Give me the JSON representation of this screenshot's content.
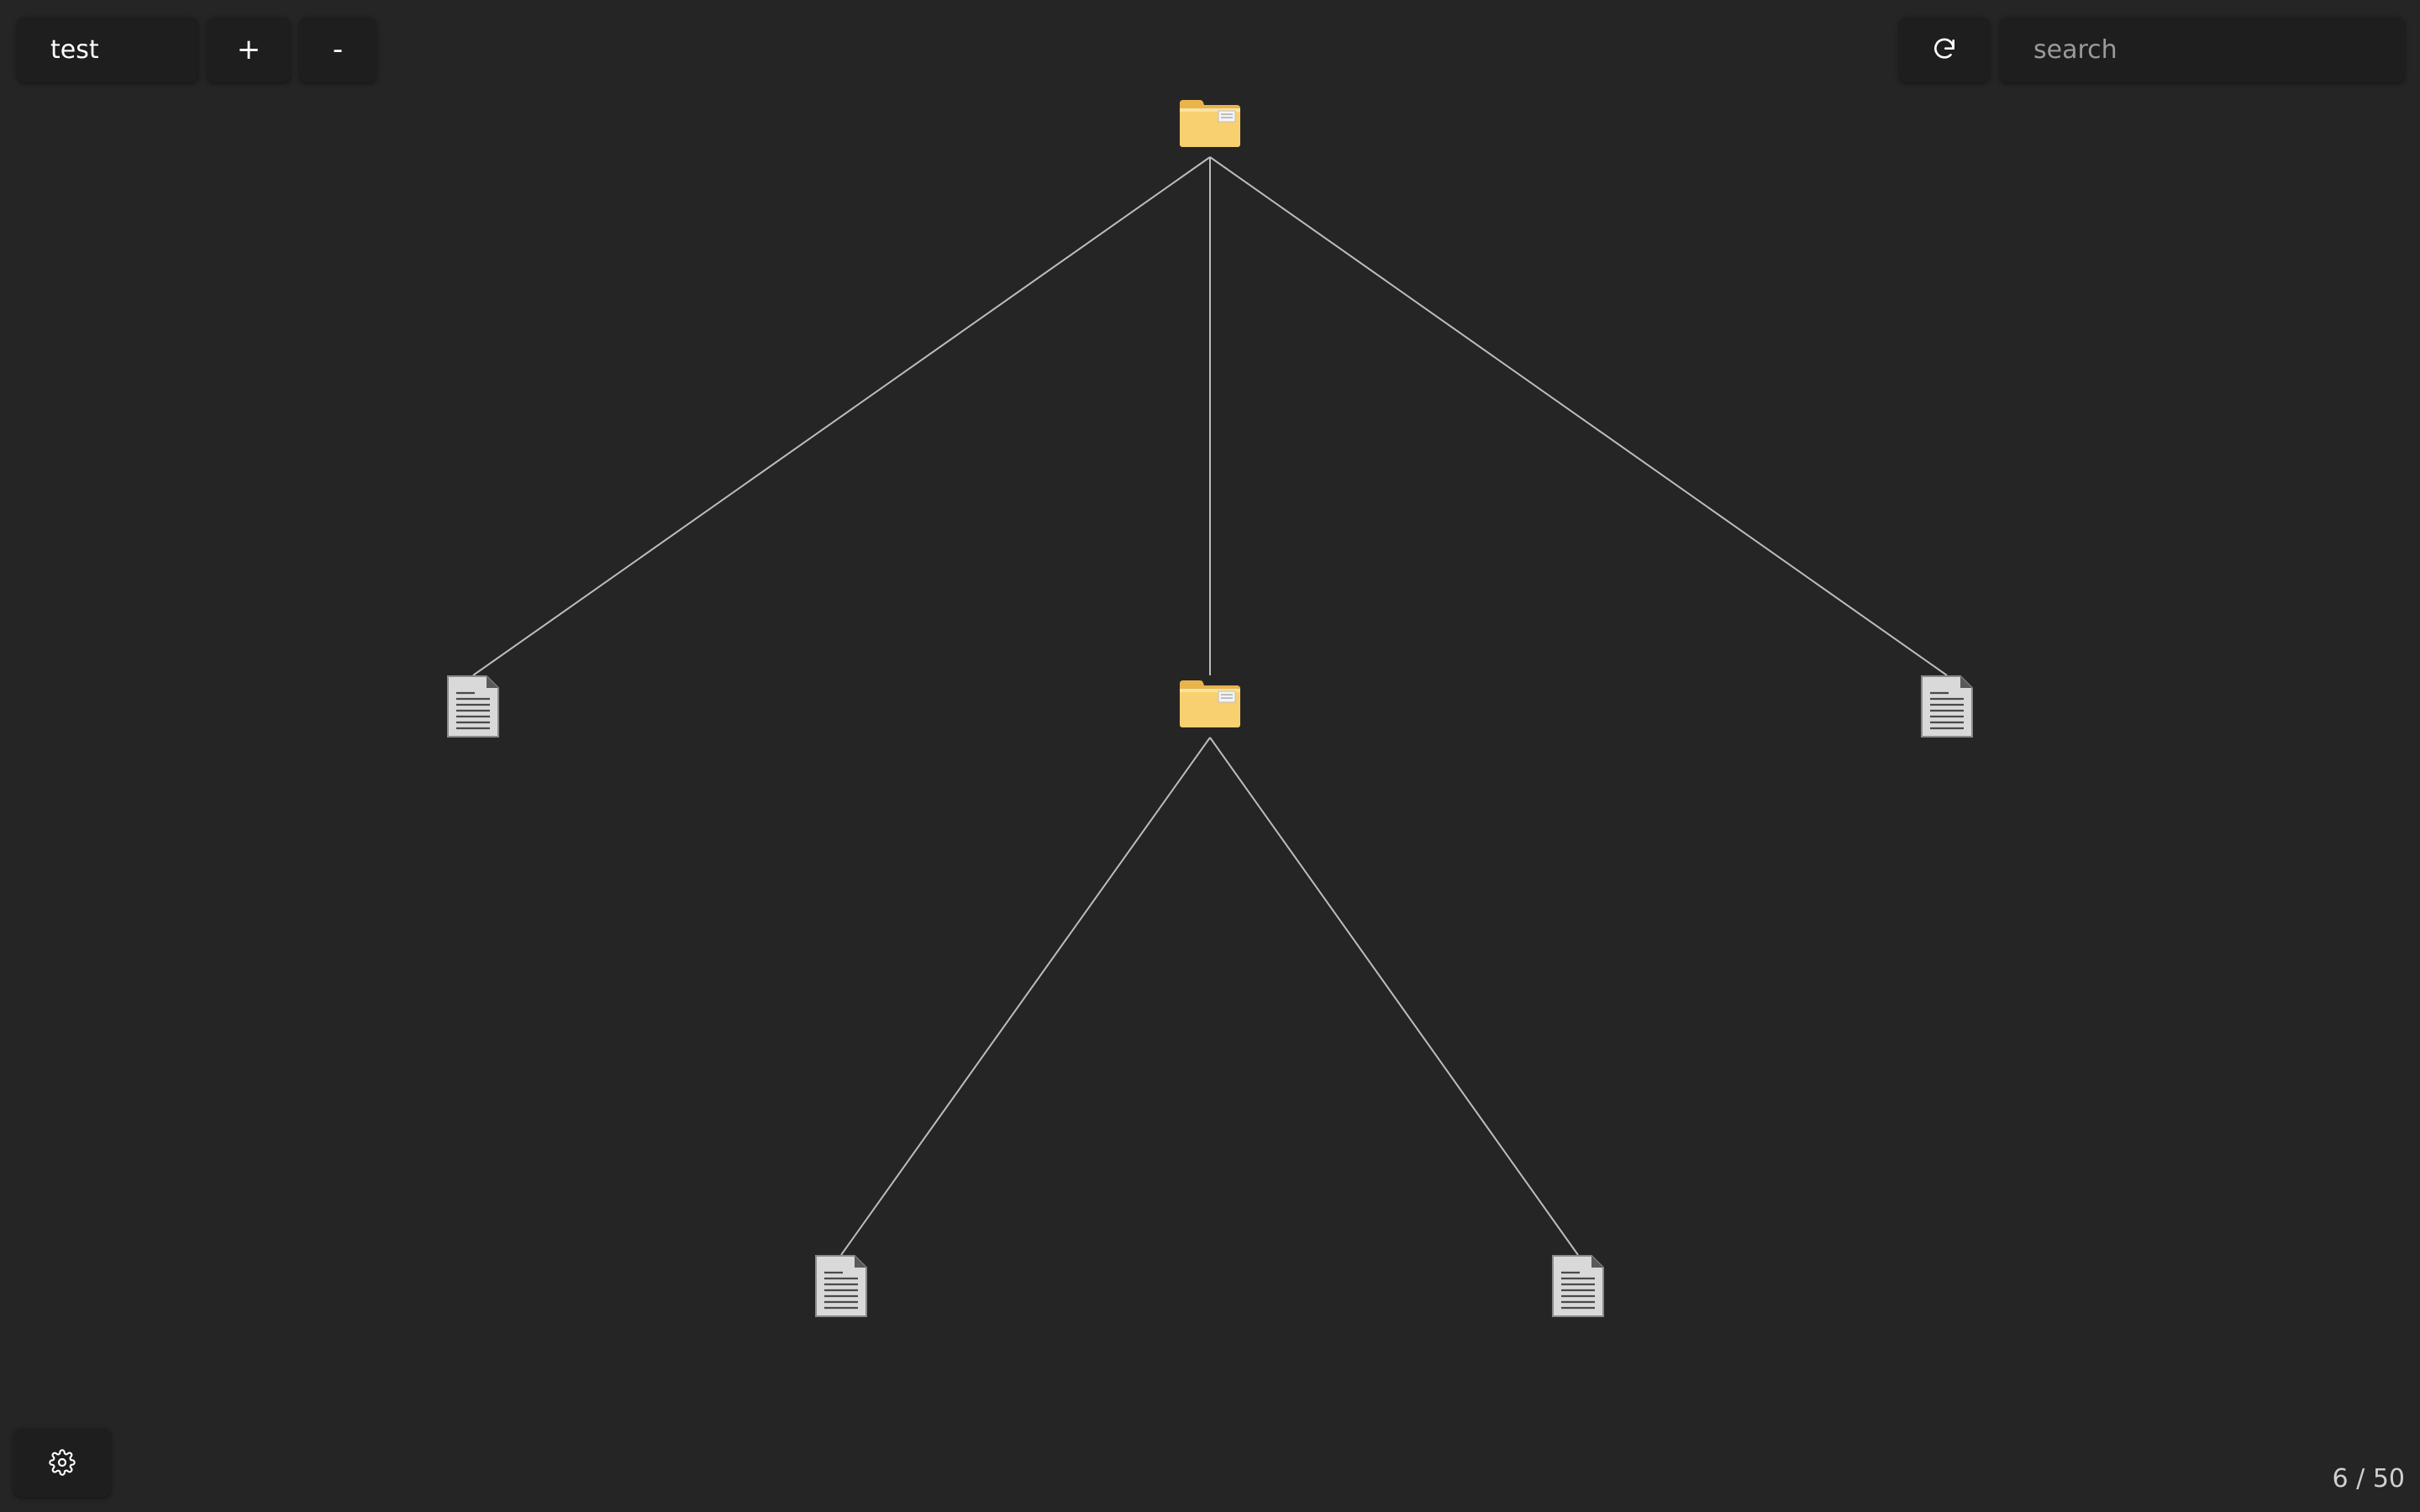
{
  "toolbar": {
    "name_label": "test",
    "zoom_in_label": "+",
    "zoom_out_label": "-",
    "refresh_icon": "refresh-icon"
  },
  "search": {
    "placeholder": "search",
    "value": ""
  },
  "footer": {
    "settings_icon": "gear-icon",
    "counter": "6 / 50"
  },
  "tree": {
    "nodes": [
      {
        "id": "root",
        "type": "folder",
        "parent": null
      },
      {
        "id": "file-left",
        "type": "file",
        "parent": "root"
      },
      {
        "id": "folder-middle",
        "type": "folder",
        "parent": "root"
      },
      {
        "id": "file-right",
        "type": "file",
        "parent": "root"
      },
      {
        "id": "file-bottom-left",
        "type": "file",
        "parent": "folder-middle"
      },
      {
        "id": "file-bottom-right",
        "type": "file",
        "parent": "folder-middle"
      }
    ]
  },
  "colors": {
    "background": "#252525",
    "button": "#1e1e1e",
    "edge": "#bdbdbd",
    "folder": "#f7cc6b",
    "file": "#d9d9d9"
  }
}
